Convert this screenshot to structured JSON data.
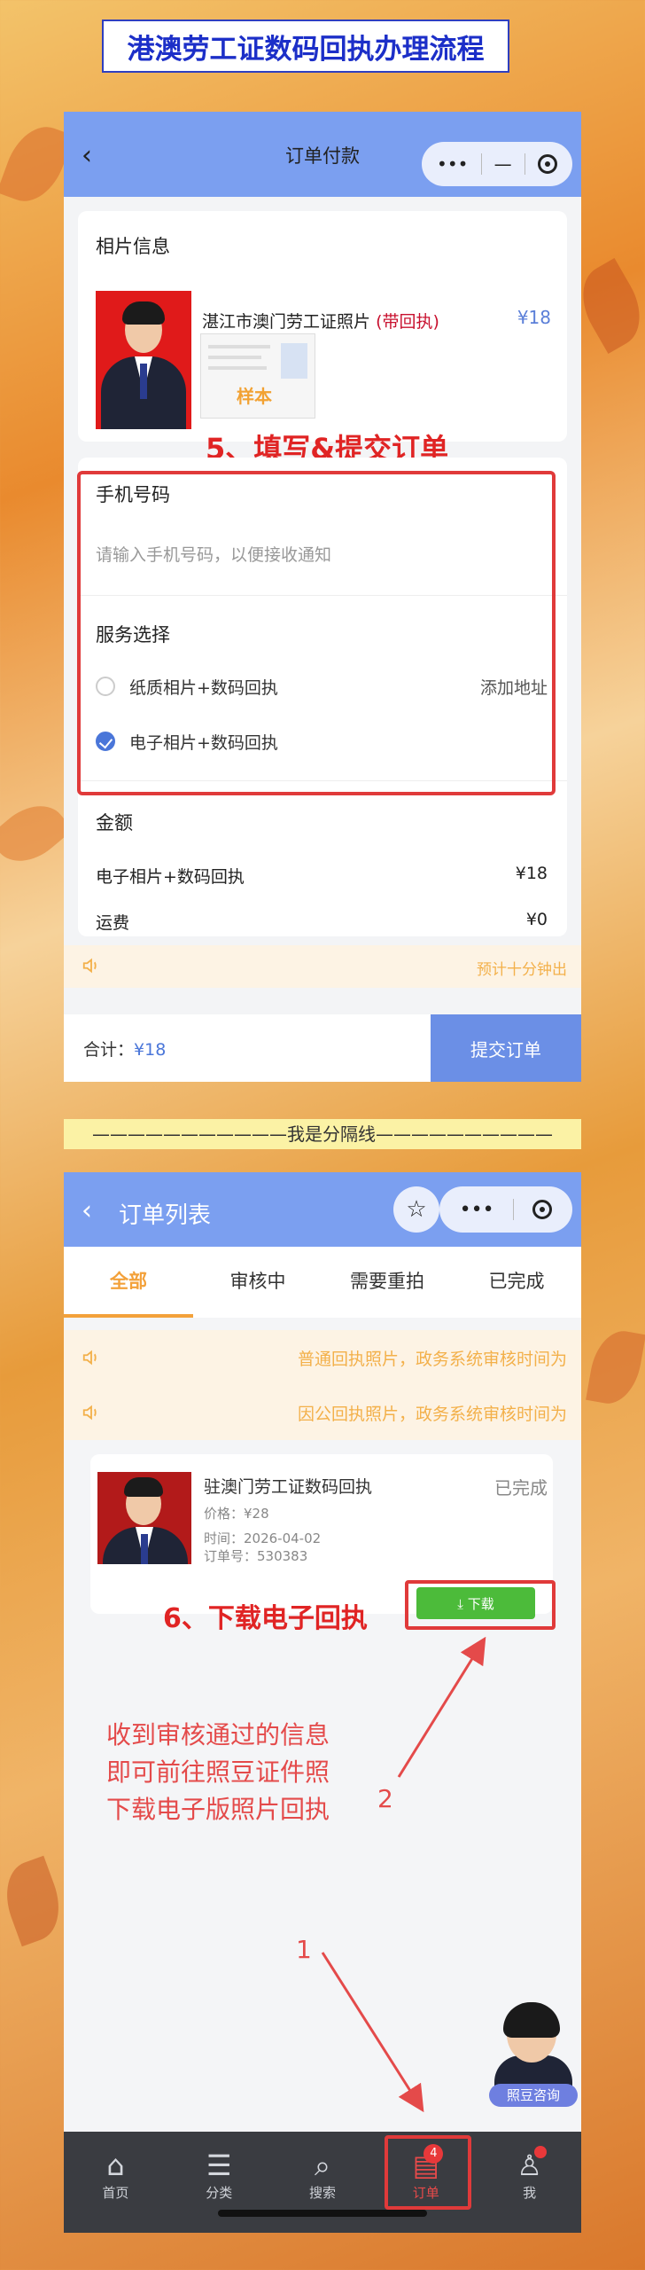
{
  "banner_title": "港澳劳工证数码回执办理流程",
  "page1": {
    "nav_title": "订单付款",
    "capsule": {
      "more": "•••",
      "minimize": "—"
    },
    "photo_section": {
      "title": "相片信息",
      "product_name": "湛江市澳门劳工证照片",
      "product_tag": "(带回执)",
      "price": "¥18",
      "sample_stamp": "样本"
    },
    "annotation_step5": "5、填写&提交订单",
    "phone": {
      "label": "手机号码",
      "placeholder": "请输入手机号码，以便接收通知",
      "value": ""
    },
    "service": {
      "label": "服务选择",
      "options": [
        {
          "label": "纸质相片+数码回执",
          "extra": "添加地址",
          "selected": false
        },
        {
          "label": "电子相片+数码回执",
          "extra": "",
          "selected": true
        }
      ]
    },
    "amount": {
      "label": "金额",
      "rows": [
        {
          "name": "电子相片+数码回执",
          "value": "¥18"
        },
        {
          "name": "运费",
          "value": "¥0"
        }
      ]
    },
    "notice": "预计十分钟出",
    "total_label": "合计：",
    "total_value": "¥18",
    "submit_label": "提交订单"
  },
  "separator": "———————————我是分隔线——————————",
  "page2": {
    "nav_title": "订单列表",
    "capsule": {
      "star": "☆",
      "more": "•••"
    },
    "tabs": [
      {
        "label": "全部",
        "active": true
      },
      {
        "label": "审核中",
        "active": false
      },
      {
        "label": "需要重拍",
        "active": false
      },
      {
        "label": "已完成",
        "active": false
      }
    ],
    "notices": [
      "普通回执照片，政务系统审核时间为",
      "因公回执照片，政务系统审核时间为"
    ],
    "order": {
      "name": "驻澳门劳工证数码回执",
      "status": "已完成",
      "price": "价格：¥28",
      "time": "时间：2026-04-02",
      "order_no": "订单号：530383",
      "download_label": "⤓ 下载"
    },
    "annotation_step6": "6、下载电子回执",
    "annotation_text": [
      "收到审核通过的信息",
      "即可前往照豆证件照",
      "下载电子版照片回执"
    ],
    "anno_num_1": "1",
    "anno_num_2": "2",
    "consult_label": "照豆咨询",
    "tabbar": [
      {
        "label": "首页",
        "icon": "home-icon",
        "active": false
      },
      {
        "label": "分类",
        "icon": "category-icon",
        "active": false
      },
      {
        "label": "搜索",
        "icon": "search-icon",
        "active": false
      },
      {
        "label": "订单",
        "icon": "order-icon",
        "active": true,
        "badge": "4"
      },
      {
        "label": "我",
        "icon": "user-icon",
        "active": false
      }
    ]
  },
  "colors": {
    "nav_blue": "#7b9ff0",
    "accent_orange": "#f3a13a",
    "annotation_red": "#e02424",
    "download_green": "#4cbb3a"
  }
}
